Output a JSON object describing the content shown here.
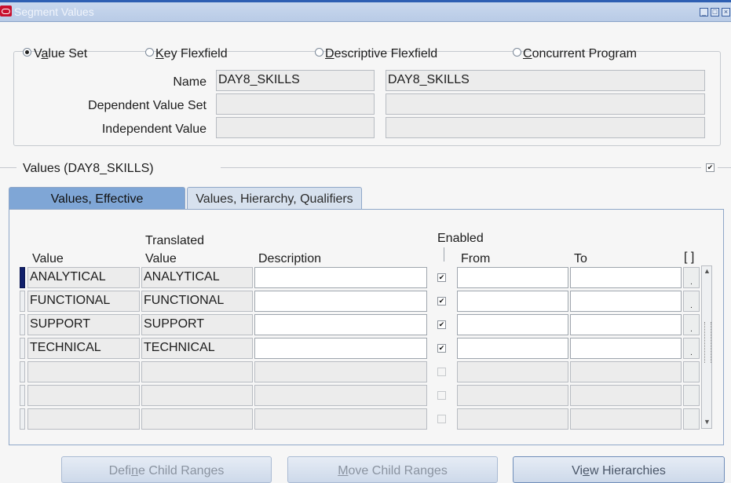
{
  "window": {
    "title": "Segment Values",
    "controls": [
      "minimize-icon",
      "maximize-icon",
      "close-icon"
    ]
  },
  "query_by": {
    "options": [
      {
        "label_pre": "V",
        "label_u": "a",
        "label_post": "lue Set",
        "selected": true
      },
      {
        "label_pre": "",
        "label_u": "K",
        "label_post": "ey Flexfield",
        "selected": false
      },
      {
        "label_pre": "",
        "label_u": "D",
        "label_post": "escriptive Flexfield",
        "selected": false
      },
      {
        "label_pre": "",
        "label_u": "C",
        "label_post": "oncurrent Program",
        "selected": false
      }
    ],
    "name_label": "Name",
    "name_value": "DAY8_SKILLS",
    "name_description": "DAY8_SKILLS",
    "dependent_label": "Dependent Value Set",
    "dependent_value": "",
    "dependent_description": "",
    "independent_label": "Independent Value",
    "independent_value": "",
    "independent_description": ""
  },
  "values_section": {
    "title": "Values (DAY8_SKILLS)",
    "checked": true
  },
  "tabs": [
    {
      "label": "Values, Effective",
      "active": true
    },
    {
      "label": "Values, Hierarchy, Qualifiers",
      "active": false
    }
  ],
  "table": {
    "col_value": "Value",
    "col_translated_top": "Translated",
    "col_translated_bottom": "Value",
    "col_description": "Description",
    "col_enabled": "Enabled",
    "col_from": "From",
    "col_to": "To",
    "col_folder": "[ ]",
    "rows": [
      {
        "value": "ANALYTICAL",
        "translated": "ANALYTICAL",
        "description": "",
        "enabled": true,
        "from": "",
        "to": ""
      },
      {
        "value": "FUNCTIONAL",
        "translated": "FUNCTIONAL",
        "description": "",
        "enabled": true,
        "from": "",
        "to": ""
      },
      {
        "value": "SUPPORT",
        "translated": "SUPPORT",
        "description": "",
        "enabled": true,
        "from": "",
        "to": ""
      },
      {
        "value": "TECHNICAL",
        "translated": "TECHNICAL",
        "description": "",
        "enabled": true,
        "from": "",
        "to": ""
      },
      {
        "value": "",
        "translated": "",
        "description": "",
        "enabled": false,
        "from": "",
        "to": ""
      },
      {
        "value": "",
        "translated": "",
        "description": "",
        "enabled": false,
        "from": "",
        "to": ""
      },
      {
        "value": "",
        "translated": "",
        "description": "",
        "enabled": false,
        "from": "",
        "to": ""
      }
    ]
  },
  "buttons": {
    "define_pre": "Defi",
    "define_u": "n",
    "define_post": "e Child Ranges",
    "move_pre": "",
    "move_u": "M",
    "move_post": "ove Child Ranges",
    "view_pre": "Vi",
    "view_u": "e",
    "view_post": "w Hierarchies"
  },
  "colors": {
    "accent_tab": "#7fa6d6",
    "current_row": "#11206b",
    "title_bar": "#b9cbe6"
  }
}
